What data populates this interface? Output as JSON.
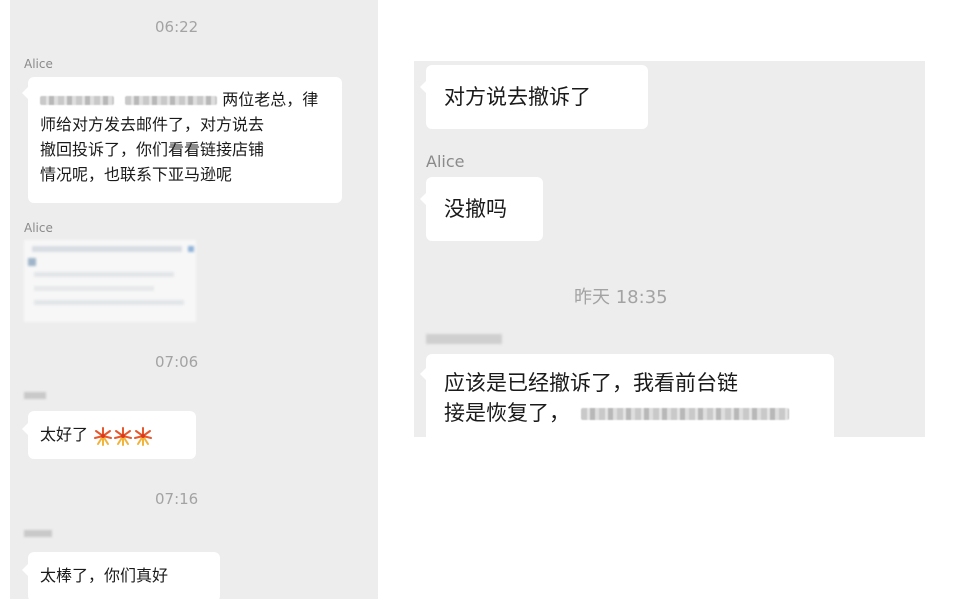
{
  "left": {
    "timestamps": [
      "06:22",
      "07:06",
      "07:16"
    ],
    "sender_alice": "Alice",
    "message1": {
      "text_line1": "两位老总，律",
      "text_line2": "师给对方发去邮件了，对方说去",
      "text_line3": "撤回投诉了，你们看看链接店铺",
      "text_line4": "情况呢，也联系下亚马逊呢"
    },
    "message3": {
      "text": "太好了",
      "emoji": [
        "firework-icon",
        "firework-icon",
        "firework-icon"
      ]
    },
    "message4": {
      "text": "太棒了，你们真好"
    }
  },
  "right": {
    "message1": {
      "text": "对方说去撤诉了"
    },
    "sender_alice": "Alice",
    "message2": {
      "text": "没撤吗"
    },
    "timestamp": "昨天 18:35",
    "message3": {
      "line1": "应该是已经撤诉了，我看前台链",
      "line2": "接是恢复了，"
    }
  },
  "colors": {
    "panel_bg": "#ededed",
    "bubble_bg": "#ffffff",
    "timestamp": "#a3a3a3",
    "sender": "#8a8a8a"
  }
}
